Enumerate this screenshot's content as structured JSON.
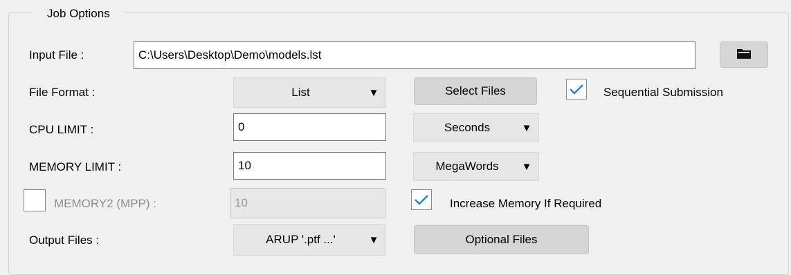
{
  "group": {
    "title": "Job Options"
  },
  "input_file": {
    "label": "Input File :",
    "value": "C:\\Users\\Desktop\\Demo\\models.lst",
    "browse_icon": "folder-icon"
  },
  "file_format": {
    "label": "File Format :",
    "selected": "List",
    "select_files_label": "Select Files"
  },
  "sequential_submission": {
    "label": "Sequential Submission",
    "checked": true
  },
  "cpu_limit": {
    "label": "CPU LIMIT :",
    "value": "0",
    "unit": "Seconds"
  },
  "memory_limit": {
    "label": "MEMORY LIMIT :",
    "value": "10",
    "unit": "MegaWords"
  },
  "memory2": {
    "label": "MEMORY2 (MPP) :",
    "value": "10",
    "checked": false,
    "enabled": false
  },
  "increase_memory": {
    "label": "Increase Memory If Required",
    "checked": true
  },
  "output_files": {
    "label": "Output Files :",
    "selected": "ARUP '.ptf ...'",
    "optional_files_label": "Optional Files"
  },
  "colors": {
    "check": "#2b82d9",
    "panel_bg": "#f0f0f0"
  }
}
